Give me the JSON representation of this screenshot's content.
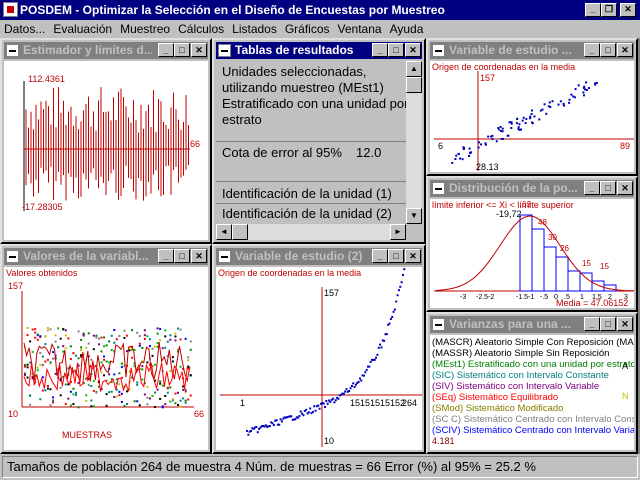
{
  "app": {
    "title": "POSDEM - Optimizar la Selección en el Diseño de Encuestas por Muestreo"
  },
  "title_buttons": {
    "minimize": "_",
    "restore": "❐",
    "close": "✕"
  },
  "menu": [
    "Datos...",
    "Evaluación",
    "Muestreo",
    "Cálculos",
    "Listados",
    "Gráficos",
    "Ventana",
    "Ayuda"
  ],
  "windows": {
    "estimador": {
      "title": "Estimador y límites d...",
      "y_max_label": "112.4361",
      "y_min_label": "-17.28305",
      "x_end_label": "66"
    },
    "tablas": {
      "title": "Tablas de resultados",
      "lines": [
        "Unidades seleccionadas,",
        "utilizando muestreo (MEst1)",
        "Estratificado con una unidad por",
        "estrato"
      ],
      "cota_label": "Cota de error al 95%",
      "cota_value": "12.0",
      "id_lines": [
        "Identificación de la unidad (1)",
        "Identificación de la unidad (2)"
      ]
    },
    "variable1": {
      "title": "Variable de estudio ...",
      "origin_label": "Origen de coordenadas en la media",
      "y_top": "157",
      "y_mean": "6",
      "x_mean": "28.13",
      "x_right": "89"
    },
    "distribucion": {
      "title": "Distribución de la po...",
      "bounds_label": "límite inferior <= Xi < límite superior",
      "left_value": "-19,72",
      "bar_labels": [
        "63",
        "48",
        "30",
        "26",
        "15",
        "15"
      ],
      "ticks": [
        "-3",
        "-2.5-2",
        "-1.5-1",
        "-.5",
        "0",
        ".5",
        "1",
        "1.5",
        "2",
        "3"
      ],
      "media_label": "Media = 47.06152"
    },
    "valores": {
      "title": "Valores de la variabl...",
      "subtitle": "Valores obtenidos",
      "y_top": "157",
      "x_left": "10",
      "x_right": "66",
      "xlabel": "MUESTRAS"
    },
    "variable2": {
      "title": "Variable de estudio (2)",
      "origin_label": "Origen de coordenadas en la media",
      "y_top": "157",
      "y_left": "1",
      "x_bottom": "10",
      "stamp": "15151515152",
      "x_right": "264"
    },
    "varianzas": {
      "title": "Varianzas para una ...",
      "legend": [
        {
          "text": "(MASCR) Aleatorio Simple Con Reposición (MASCR)",
          "color": "#000000"
        },
        {
          "text": "(MASSR) Aleatorio Simple Sin Reposición",
          "color": "#000000"
        },
        {
          "text": "(MEst1) Estratificado con una unidad por estrato",
          "color": "#008000"
        },
        {
          "text": "(SIC) Sistemático con Intervalo Constante",
          "color": "#008080"
        },
        {
          "text": "(SIV) Sistemático con Intervalo Variable",
          "color": "#800080"
        },
        {
          "text": "(SEq) Sistemático Equilibrado",
          "color": "#ff0000"
        },
        {
          "text": "(SMod) Sistemático Modificado",
          "color": "#808000"
        },
        {
          "text": "(SC C) Sistemático Centrado con Intervalo Constante",
          "color": "#808080"
        },
        {
          "text": "(SCIV) Sistemático Centrado con Intervalo Variable",
          "color": "#0000ff"
        }
      ],
      "side_marks": [
        "A",
        "N"
      ],
      "bottom_value": "4.181"
    }
  },
  "status": {
    "text": "Tamaños de población  264 de muestra  4 Núm. de muestras =  66 Error (%) al 95% =  25.2 %"
  },
  "colors": {
    "active_title": "#000080",
    "inactive_title": "#808080",
    "chart_red": "#c00000",
    "point_blue": "#0000c0"
  }
}
